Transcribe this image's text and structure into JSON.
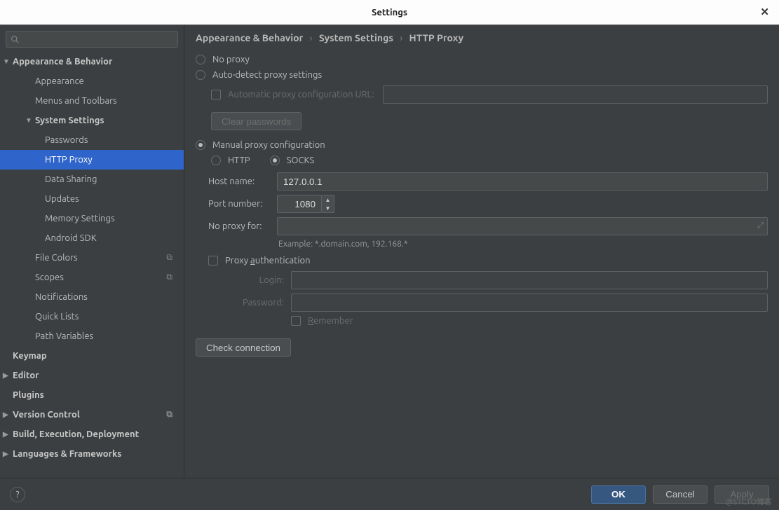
{
  "title": "Settings",
  "breadcrumb": [
    "Appearance & Behavior",
    "System Settings",
    "HTTP Proxy"
  ],
  "sidebar": {
    "items": [
      {
        "label": "Appearance & Behavior",
        "bold": true,
        "arrow": "down",
        "level": 0
      },
      {
        "label": "Appearance",
        "level": 1
      },
      {
        "label": "Menus and Toolbars",
        "level": 1
      },
      {
        "label": "System Settings",
        "bold": true,
        "arrow": "down",
        "level": 1
      },
      {
        "label": "Passwords",
        "level": 2
      },
      {
        "label": "HTTP Proxy",
        "level": 2,
        "selected": true
      },
      {
        "label": "Data Sharing",
        "level": 2
      },
      {
        "label": "Updates",
        "level": 2
      },
      {
        "label": "Memory Settings",
        "level": 2
      },
      {
        "label": "Android SDK",
        "level": 2
      },
      {
        "label": "File Colors",
        "level": 1,
        "tag": true
      },
      {
        "label": "Scopes",
        "level": 1,
        "tag": true
      },
      {
        "label": "Notifications",
        "level": 1
      },
      {
        "label": "Quick Lists",
        "level": 1
      },
      {
        "label": "Path Variables",
        "level": 1
      },
      {
        "label": "Keymap",
        "bold": true,
        "level": 0
      },
      {
        "label": "Editor",
        "bold": true,
        "arrow": "right",
        "level": 0
      },
      {
        "label": "Plugins",
        "bold": true,
        "level": 0
      },
      {
        "label": "Version Control",
        "bold": true,
        "arrow": "right",
        "level": 0,
        "tag": true
      },
      {
        "label": "Build, Execution, Deployment",
        "bold": true,
        "arrow": "right",
        "level": 0
      },
      {
        "label": "Languages & Frameworks",
        "bold": true,
        "arrow": "right",
        "level": 0
      }
    ]
  },
  "proxy": {
    "no_proxy_label": "No proxy",
    "auto_detect_label": "Auto-detect proxy settings",
    "auto_url_label": "Automatic proxy configuration URL:",
    "clear_passwords_label": "Clear passwords",
    "manual_label": "Manual proxy configuration",
    "http_label": "HTTP",
    "socks_label": "SOCKS",
    "host_label": "Host name:",
    "host_value": "127.0.0.1",
    "port_label": "Port number:",
    "port_value": "1080",
    "noproxyfor_label": "No proxy for:",
    "example_text": "Example: *.domain.com, 192.168.*",
    "auth_label": "Proxy authentication",
    "login_label": "Login:",
    "password_label": "Password:",
    "remember_label": "Remember",
    "check_connection_label": "Check connection"
  },
  "footer": {
    "ok": "OK",
    "cancel": "Cancel",
    "apply": "Apply"
  },
  "watermark": "@51CTO博客"
}
